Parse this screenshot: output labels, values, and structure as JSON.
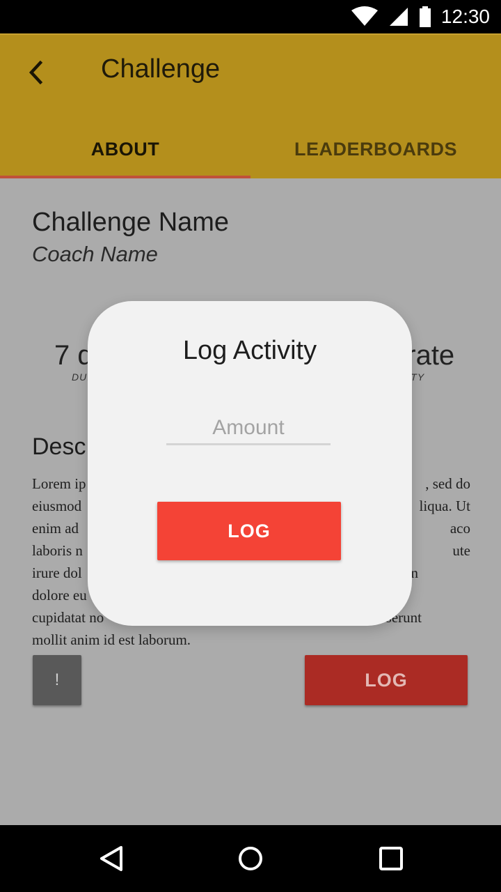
{
  "status_bar": {
    "time": "12:30",
    "icons": [
      "wifi-icon",
      "signal-icon",
      "battery-icon"
    ]
  },
  "app_bar": {
    "back_icon": "chevron-left-icon",
    "title": "Challenge"
  },
  "tabs": [
    {
      "label": "ABOUT",
      "active": true
    },
    {
      "label": "LEADERBOARDS",
      "active": false
    }
  ],
  "challenge": {
    "name": "Challenge Name",
    "coach": "Coach Name",
    "duration_value_visible": "7 d",
    "duration_label_visible": "DUI",
    "difficulty_value_visible": "erate",
    "difficulty_label_visible": "LTY"
  },
  "description": {
    "heading_visible": "Desc",
    "body_lines": [
      {
        "left": "Lorem ip",
        "right": ", sed do"
      },
      {
        "left": "eiusmod",
        "right": "liqua. Ut"
      },
      {
        "left": "enim ad",
        "right": "aco"
      },
      {
        "left": "laboris n",
        "right": "ute"
      },
      {
        "left": "irure dol",
        "right": "n"
      },
      {
        "left": "dolore eu",
        "right": ""
      },
      {
        "left": "cupidatat no",
        "right": "serunt"
      },
      {
        "left": "mollit anim id est laborum.",
        "right": ""
      }
    ]
  },
  "buttons": {
    "info_label": "!",
    "log_label": "LOG"
  },
  "dialog": {
    "title": "Log Activity",
    "amount_placeholder": "Amount",
    "amount_value": "",
    "log_label": "LOG"
  },
  "nav_bar": {
    "icons": [
      "back-triangle-icon",
      "home-circle-icon",
      "recents-square-icon"
    ]
  },
  "colors": {
    "app_bar": "#b48f1c",
    "tab_indicator": "#c0513a",
    "dim_background": "#ababab",
    "dialog_background": "#f2f2f2",
    "dialog_button": "#f44336",
    "log_button_dimmed": "#ab2b24",
    "info_button_dimmed": "#595959"
  }
}
